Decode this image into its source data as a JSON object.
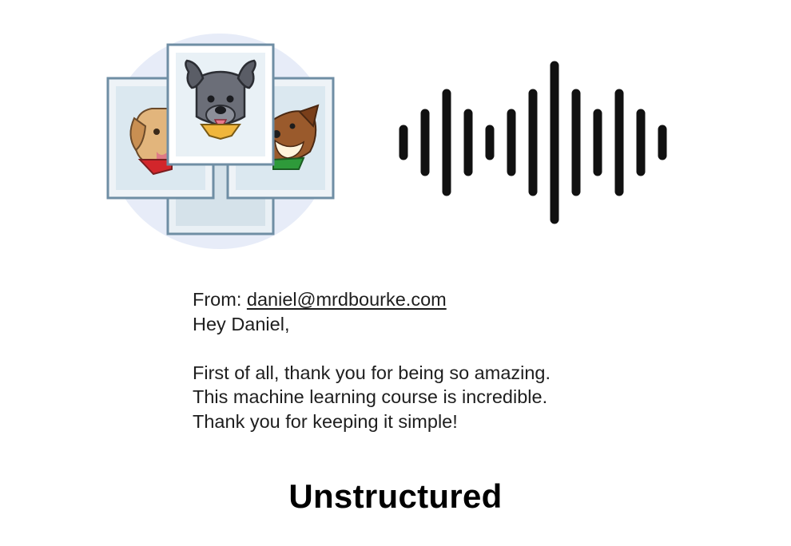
{
  "illustration": {
    "cards_icon": "dog-photo-cards-icon",
    "audio_icon": "sound-wave-icon",
    "colors": {
      "circle": "#e6ebf7",
      "card_border": "#6f8ea4",
      "card_fill": "#dbe8f0",
      "wave": "#111111"
    }
  },
  "email": {
    "from_label": "From:",
    "from_address": "daniel@mrdbourke.com",
    "greeting": "Hey Daniel,",
    "body_lines": [
      "First of all, thank you for being so amazing.",
      "This machine learning course is incredible.",
      "Thank you for keeping it simple!"
    ]
  },
  "caption": "Unstructured"
}
